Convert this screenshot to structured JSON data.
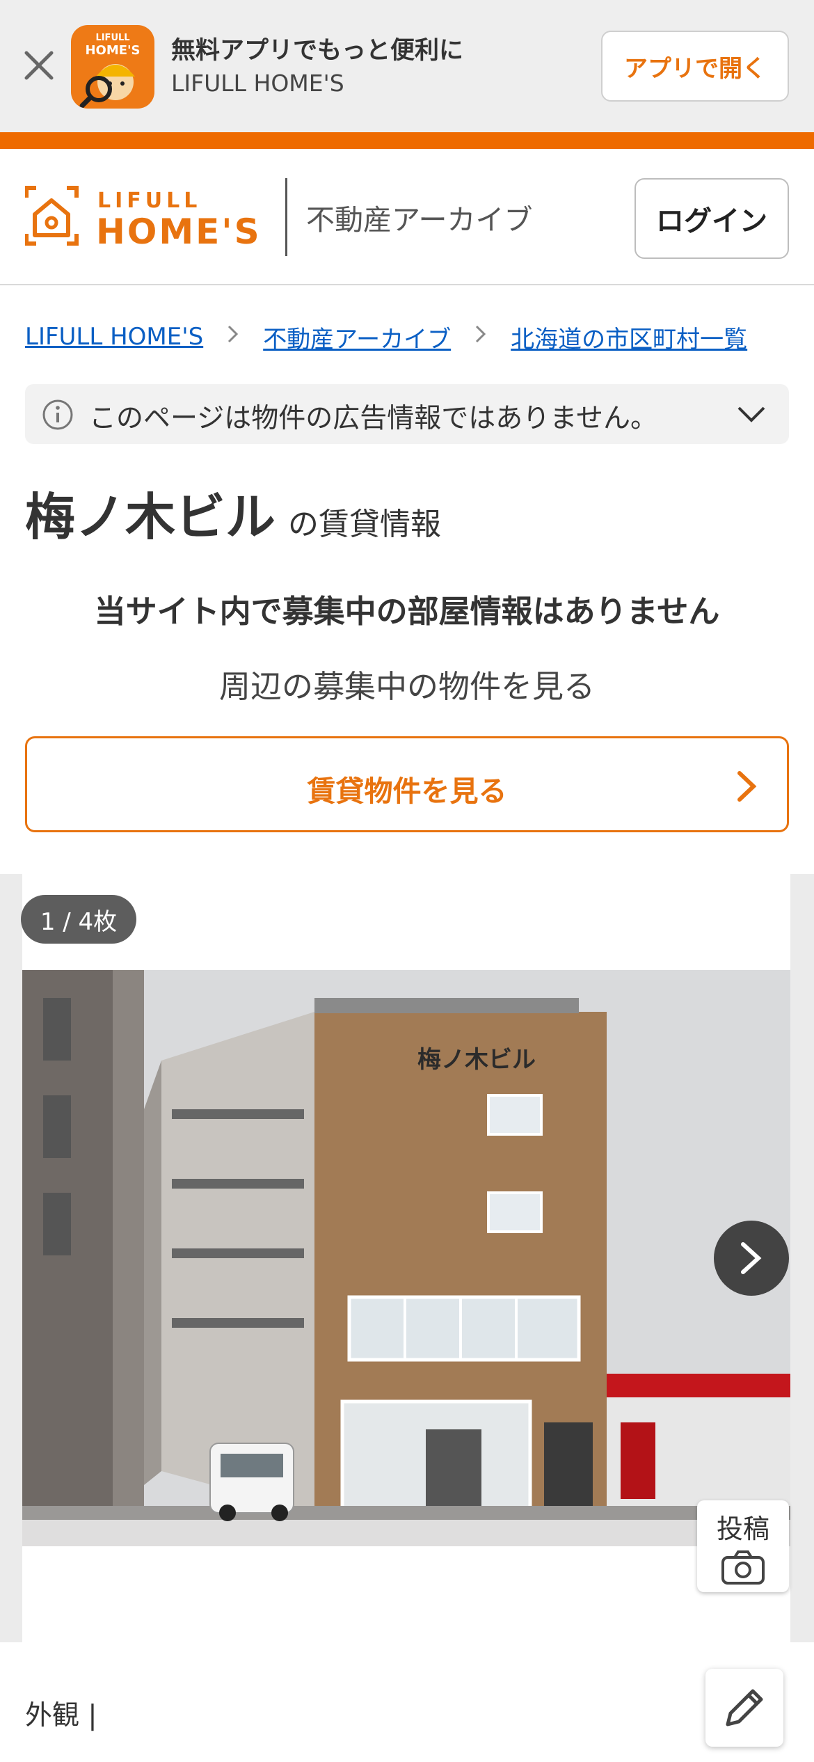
{
  "app_banner": {
    "title": "無料アプリでもっと便利に",
    "subtitle": "LIFULL HOME'S",
    "open_button": "アプリで開く",
    "icon_text_top": "LIFULL",
    "icon_text_bottom": "HOME'S"
  },
  "header": {
    "logo_top": "LIFULL",
    "logo_bottom": "HOME'S",
    "section": "不動産アーカイブ",
    "login": "ログイン"
  },
  "breadcrumb": [
    "LIFULL HOME'S",
    "不動産アーカイブ",
    "北海道の市区町村一覧"
  ],
  "notice": {
    "text": "このページは物件の広告情報ではありません。"
  },
  "property": {
    "name": "梅ノ木ビル",
    "suffix": "の賃貸情報",
    "no_rooms": "当サイト内で募集中の部屋情報はありません",
    "nearby": "周辺の募集中の物件を見る",
    "rent_button": "賃貸物件を見る"
  },
  "gallery": {
    "counter": "1 / 4枚",
    "post_label": "投稿",
    "building_sign": "梅ノ木ビル"
  },
  "caption": {
    "text": "外観 |"
  },
  "colors": {
    "accent": "#ee6a00",
    "link": "#0b5fc4",
    "button_text": "#e8730f"
  }
}
